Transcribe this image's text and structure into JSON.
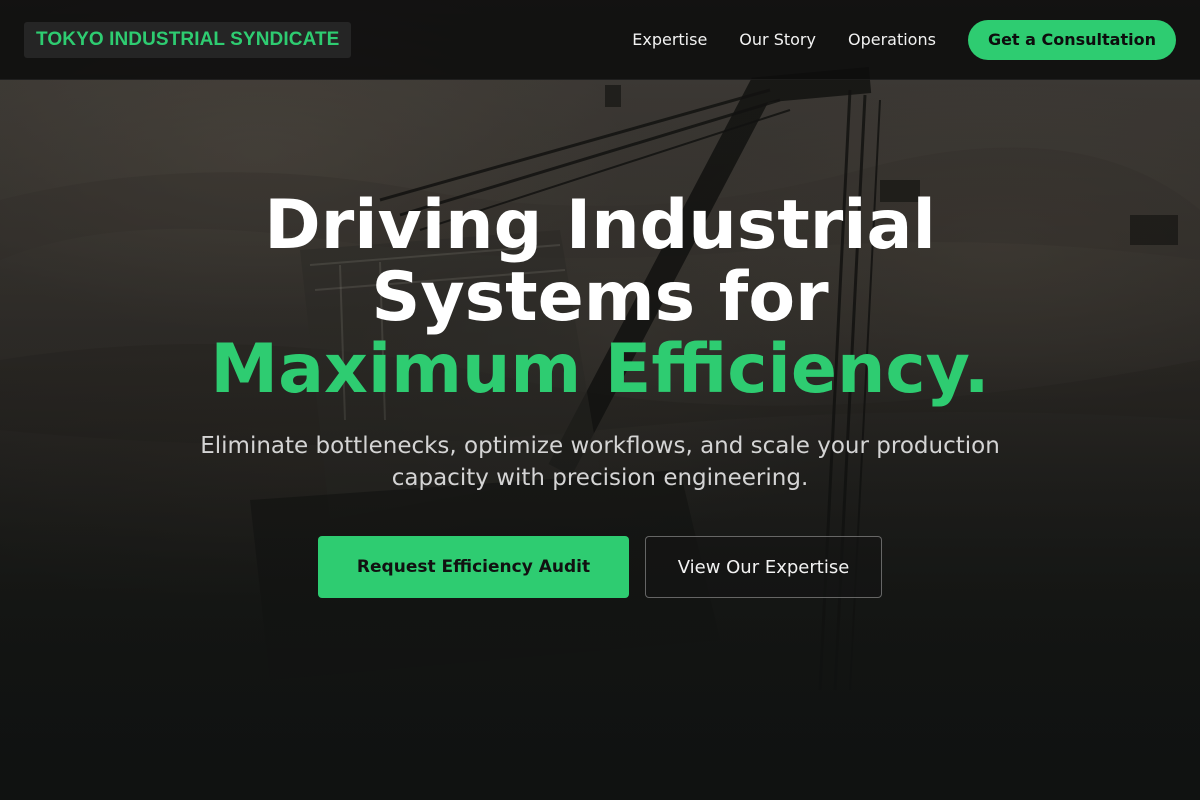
{
  "navbar": {
    "logo": "TOKYO INDUSTRIAL SYNDICATE",
    "links": [
      "Expertise",
      "Our Story",
      "Operations"
    ],
    "cta": "Get a Consultation"
  },
  "hero": {
    "headline_line1": "Driving Industrial",
    "headline_line2": "Systems for",
    "headline_accent": "Maximum Efficiency.",
    "subhead": "Eliminate bottlenecks, optimize workflows, and scale your production capacity with precision engineering.",
    "primary_button": "Request Efficiency Audit",
    "secondary_button": "View Our Expertise",
    "background_image": "mining-excavator-quarry-photo"
  },
  "colors": {
    "accent": "#2ecc71",
    "nav_background": "#0c0c0c",
    "page_background": "#121413"
  }
}
